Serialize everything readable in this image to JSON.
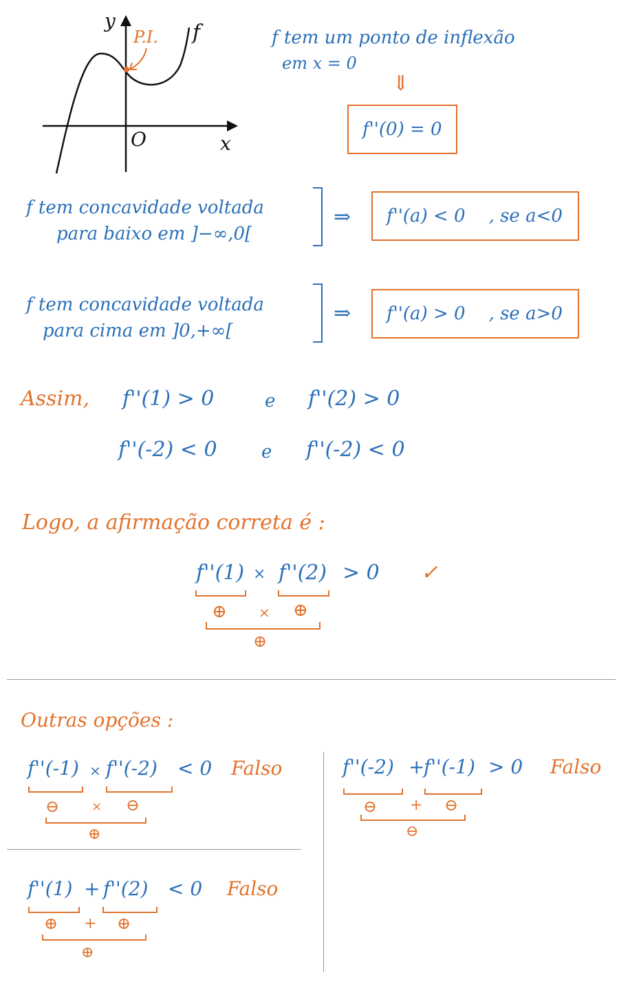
{
  "graph": {
    "y_label": "y",
    "x_label": "x",
    "origin_label": "O",
    "pi_label": "P.I.",
    "f_label": "f"
  },
  "inflection": {
    "line1": "f tem um ponto de inflexão",
    "line2": "em x = 0",
    "arrow": "⇓",
    "result": "f''(0) = 0"
  },
  "concave_down": {
    "line1": "f tem concavidade voltada",
    "line2": "para baixo em ]−∞,0[",
    "implies": "⇒",
    "result_expr": "f''(a) < 0",
    "result_cond": ", se a<0"
  },
  "concave_up": {
    "line1": "f tem concavidade voltada",
    "line2": "para cima em ]0,+∞[",
    "implies": "⇒",
    "result_expr": "f''(a) > 0",
    "result_cond": ", se a>0"
  },
  "assim": {
    "word": "Assim,",
    "r1a": "f''(1) > 0",
    "r1e": "e",
    "r1b": "f''(2) > 0",
    "r2a": "f''(-2) < 0",
    "r2e": "e",
    "r2b": "f''(-2) < 0"
  },
  "logo": {
    "text": "Logo, a afirmação correta é :",
    "f1": "f''(1)",
    "times": "×",
    "f2": "f''(2)",
    "gt": "> 0",
    "check": "✓",
    "s1": "⊕",
    "st": "×",
    "s2": "⊕",
    "res": "⊕"
  },
  "outras": {
    "title": "Outras opções :",
    "opt1": {
      "a": "f''(-1)",
      "op": "×",
      "b": "f''(-2)",
      "rel": "< 0",
      "verdict": "Falso",
      "s1": "⊖",
      "sop": "×",
      "s2": "⊖",
      "res": "⊕"
    },
    "opt2": {
      "a": "f''(-2)",
      "op": "+",
      "b": "f''(-1)",
      "rel": "> 0",
      "verdict": "Falso",
      "s1": "⊖",
      "sop": "+",
      "s2": "⊖",
      "res": "⊖"
    },
    "opt3": {
      "a": "f''(1)",
      "op": "+",
      "b": "f''(2)",
      "rel": "< 0",
      "verdict": "Falso",
      "s1": "⊕",
      "sop": "+",
      "s2": "⊕",
      "res": "⊕"
    }
  },
  "colors": {
    "blue": "#2a6fb8",
    "orange": "#e2722c",
    "black": "#111111"
  }
}
